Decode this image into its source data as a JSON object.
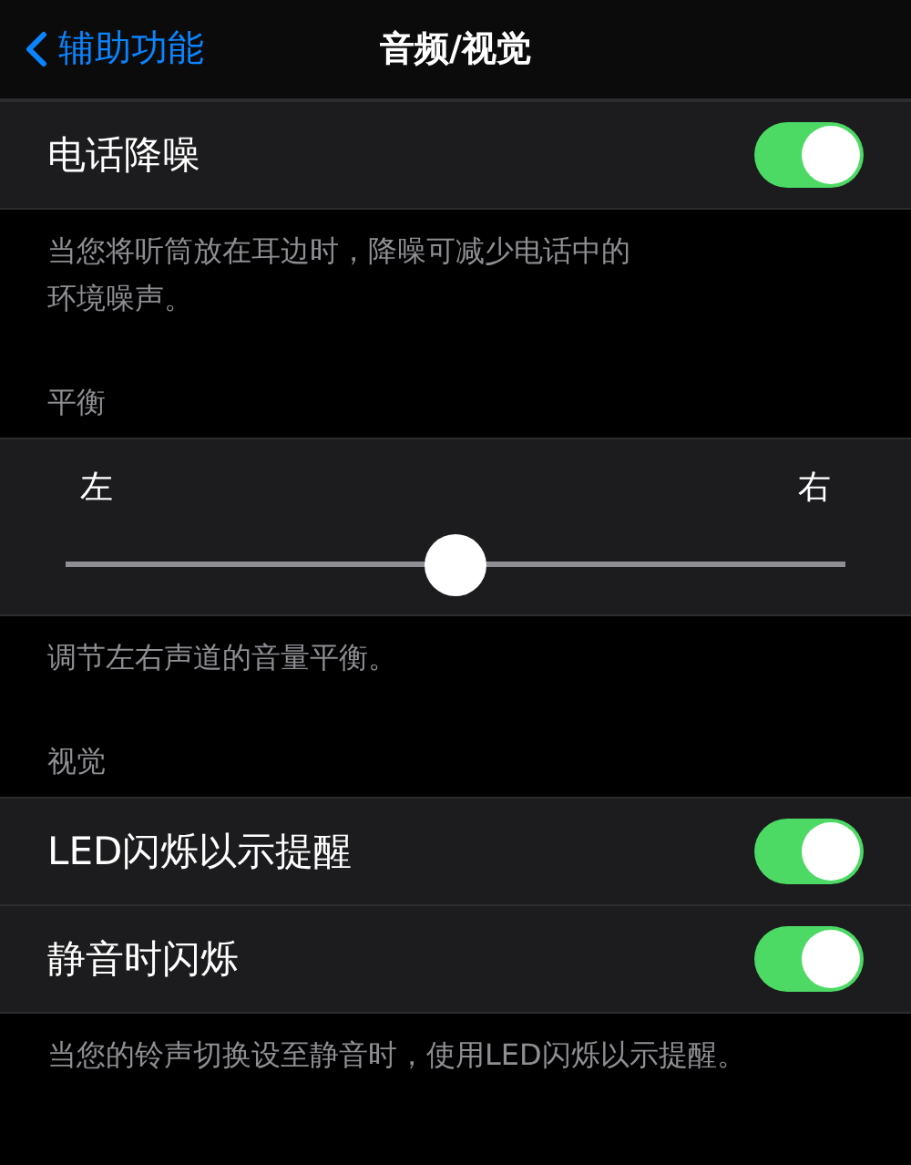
{
  "nav": {
    "back": "辅助功能",
    "title": "音频/视觉"
  },
  "groups": [
    {
      "rows": [
        {
          "kind": "toggle",
          "label": "电话降噪",
          "on": true
        }
      ],
      "footer": "当您将听筒放在耳边时，降噪可减少电话中的环境噪声。"
    },
    {
      "header": "平衡",
      "rows": [
        {
          "kind": "balance",
          "left": "左",
          "right": "右",
          "level": 0.5
        }
      ],
      "footer": "调节左右声道的音量平衡。"
    },
    {
      "header": "视觉",
      "rows": [
        {
          "kind": "toggle",
          "label": "LED闪烁以示提醒",
          "on": true
        },
        {
          "kind": "toggle",
          "label": "静音时闪烁",
          "on": true
        }
      ],
      "footer": "当您的铃声切换设至静音时，使用LED闪烁以示提醒。"
    }
  ]
}
